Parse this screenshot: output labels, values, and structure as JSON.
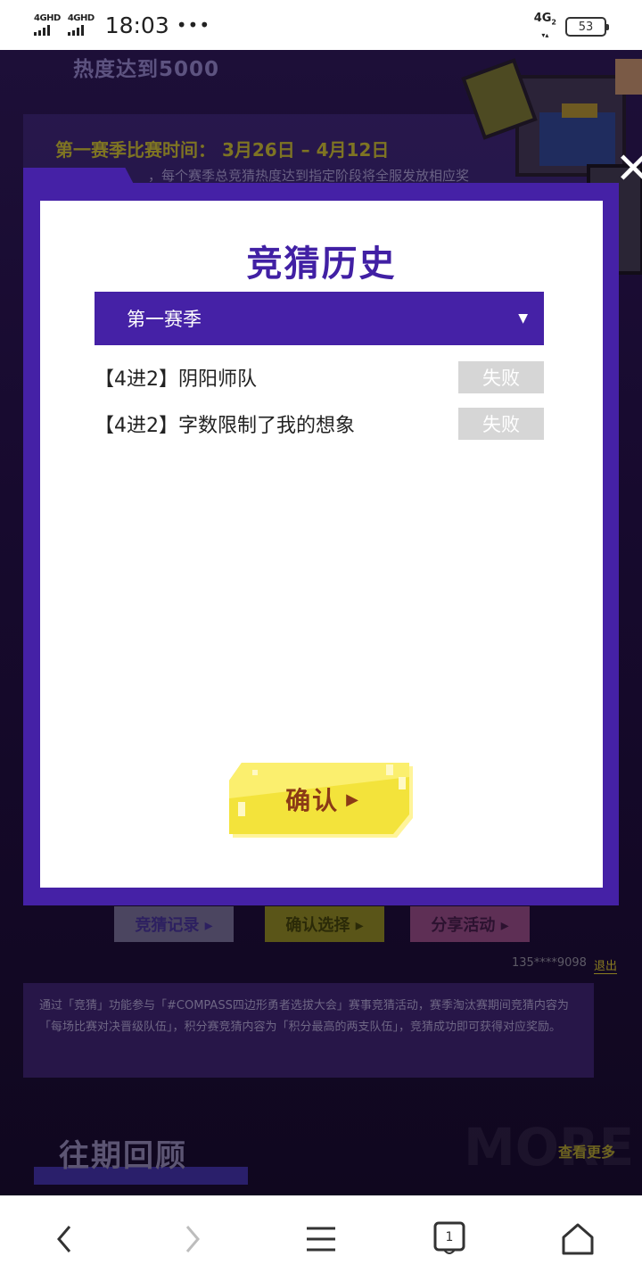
{
  "status_bar": {
    "network_1": "4GHD",
    "network_2": "4GHD",
    "time": "18:03",
    "more": "•••",
    "signal_right": "4G",
    "signal_right_sub": "2",
    "battery": "53"
  },
  "background": {
    "heat_text": "热度达到5000",
    "season_time": "第一赛季比赛时间：  3月26日 – 4月12日",
    "season_note": "，每个赛季总竞猜热度达到指定阶段将全服发放相应奖",
    "buttons": {
      "guess_record": "竞猜记录 ▸",
      "confirm_choice": "确认选择 ▸",
      "share_activity": "分享活动 ▸"
    },
    "phone": "135****9098",
    "logout": "退出",
    "description": "通过「竞猜」功能参与「#COMPASS四边形勇者选拔大会」赛事竞猜活动，赛季淘汰赛期间竞猜内容为「每场比赛对决晋级队伍」，积分赛竞猜内容为「积分最高的两支队伍」，竞猜成功即可获得对应奖励。",
    "review_title": "往期回顾",
    "see_more": "查看更多",
    "more_ghost": "MORE"
  },
  "modal": {
    "title": "竞猜历史",
    "season_select": "第一赛季",
    "caret": "▼",
    "records": [
      {
        "name": "【4进2】阴阳师队",
        "result": "失败"
      },
      {
        "name": "【4进2】字数限制了我的想象",
        "result": "失败"
      }
    ],
    "confirm_label": "确认",
    "confirm_arrow": "▶",
    "close": "✕"
  },
  "nav_bar": {
    "tab_count": "1"
  },
  "colors": {
    "modal_purple": "#4521a6",
    "title_purple": "#4120a4",
    "confirm_yellow": "#f3e33b",
    "failed_gray": "#d6d6d6"
  }
}
